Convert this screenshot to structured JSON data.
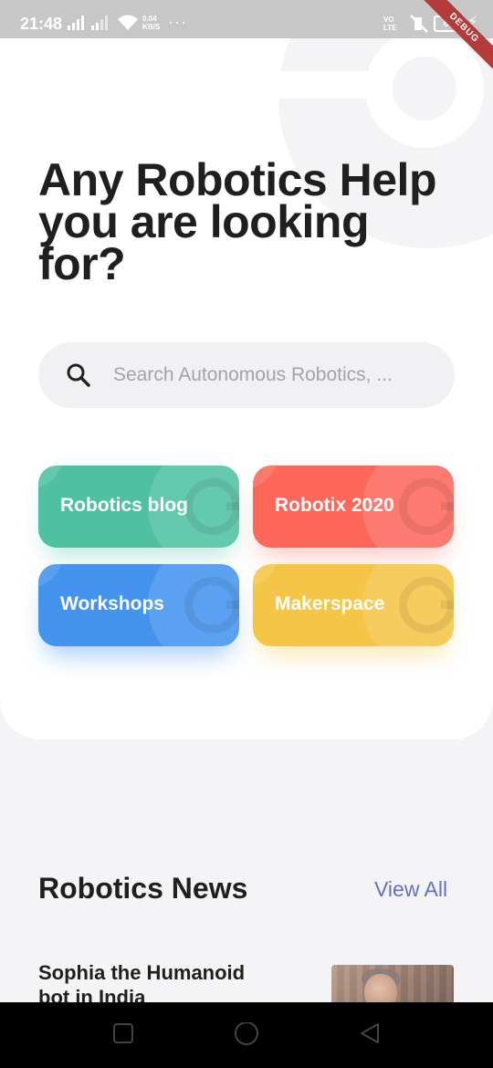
{
  "status_bar": {
    "time": "21:48",
    "net_speed_value": "0.04",
    "net_speed_unit": "KB/S",
    "overflow": "···",
    "volte": "VoLTE",
    "volte_line1": "VO",
    "volte_line2": "LTE",
    "battery": "68",
    "debug_banner": "DEBUG"
  },
  "hero": {
    "title": "Any Robotics Help you are looking for?"
  },
  "search": {
    "placeholder": "Search Autonomous Robotics, ..."
  },
  "categories": [
    {
      "label": "Robotics blog",
      "color": "#4fc1a1"
    },
    {
      "label": "Robotix 2020",
      "color": "#fc675a"
    },
    {
      "label": "Workshops",
      "color": "#4393ef"
    },
    {
      "label": "Makerspace",
      "color": "#f5c547"
    }
  ],
  "news": {
    "title": "Robotics News",
    "view_all": "View All",
    "items": [
      {
        "headline": "Sophia the Humanoid bot in India",
        "image": "sophia-robot-photo"
      }
    ]
  },
  "colors": {
    "accent_link": "#6470c8",
    "text_dark": "#1f1f1f",
    "background": "#f4f4f6"
  },
  "icons": [
    "search-icon",
    "wifi-icon",
    "mute-icon",
    "battery-icon",
    "nav-square-icon",
    "nav-circle-icon",
    "nav-triangle-icon"
  ]
}
